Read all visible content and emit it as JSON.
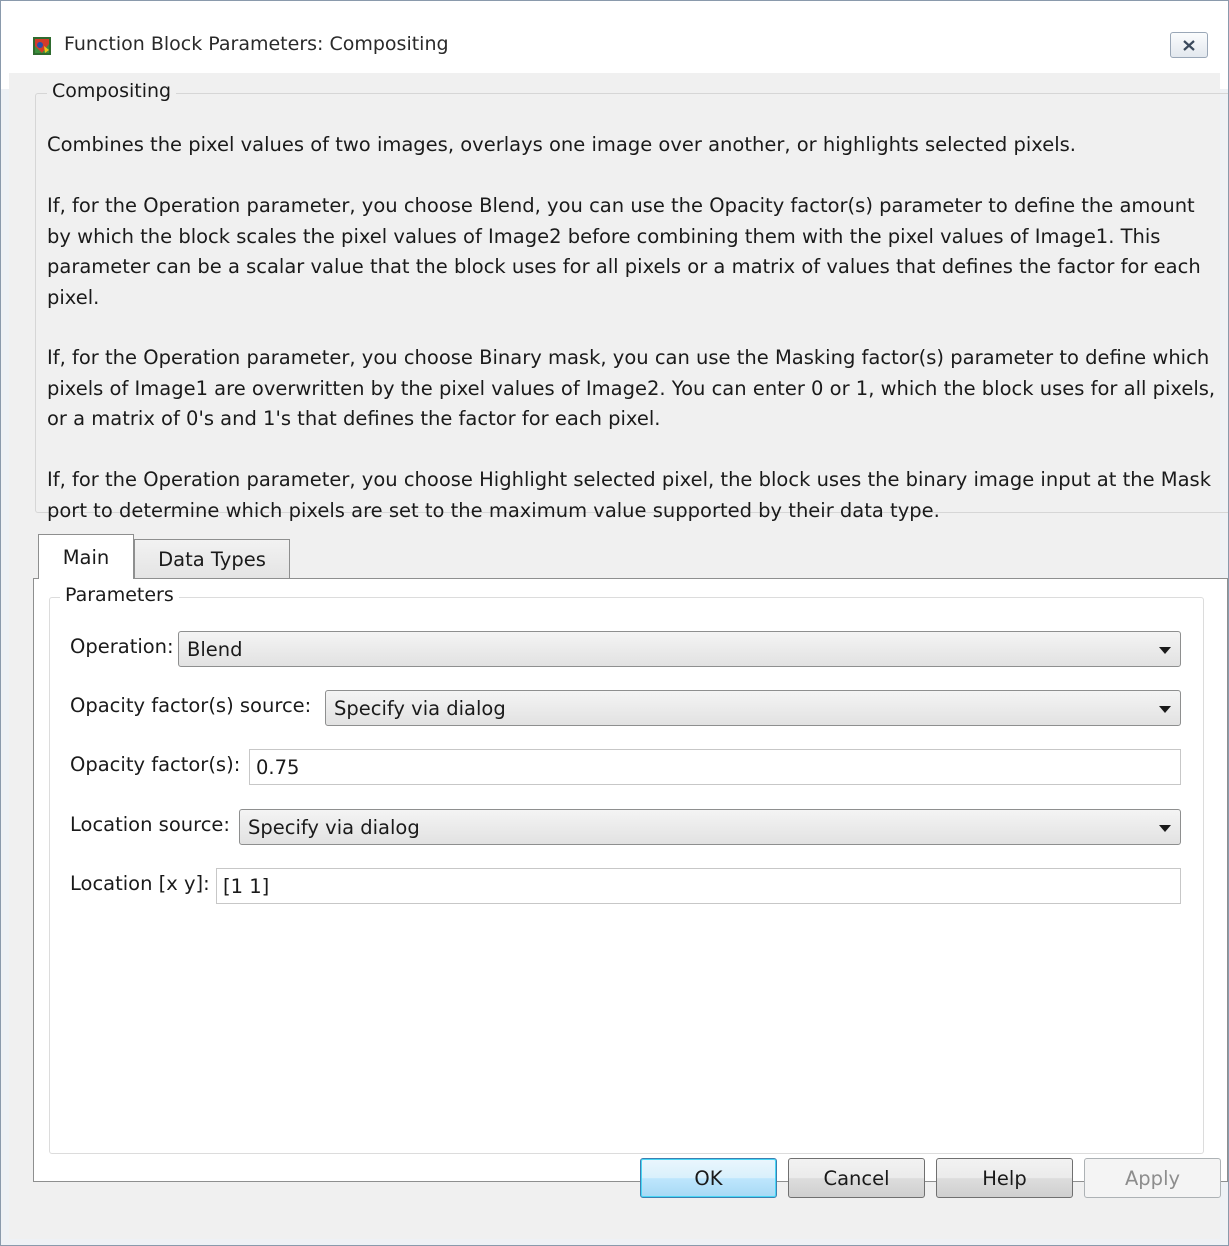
{
  "window": {
    "title": "Function Block Parameters: Compositing",
    "icon": "simulink-block-icon",
    "close_icon": "close-icon"
  },
  "description": {
    "group_label": "Compositing",
    "paragraphs": [
      "Combines the pixel values of two images, overlays one image over another, or highlights selected pixels.",
      "If, for the Operation parameter, you choose Blend, you can use the Opacity factor(s) parameter to define the amount by which the block scales the pixel values of Image2 before combining them with the pixel values of Image1. This parameter can be a scalar value that the block uses for all pixels or a matrix of values that defines the factor for each pixel.",
      "If, for the Operation parameter, you choose Binary mask, you can use the Masking factor(s) parameter to define which pixels of Image1 are overwritten by the pixel values of Image2. You can enter 0 or 1, which the block uses for all pixels, or a matrix of 0's and 1's that defines the factor for each pixel.",
      "If, for the Operation parameter, you choose Highlight selected pixel, the block uses the binary image input at the Mask port to determine which pixels are set to the maximum value supported by their data type."
    ]
  },
  "tabs": [
    {
      "label": "Main",
      "active": true
    },
    {
      "label": "Data Types",
      "active": false
    }
  ],
  "parameters": {
    "group_label": "Parameters",
    "operation": {
      "label": "Operation:",
      "value": "Blend"
    },
    "opacity_source": {
      "label": "Opacity factor(s) source:",
      "value": "Specify via dialog"
    },
    "opacity": {
      "label": "Opacity factor(s):",
      "value": "0.75"
    },
    "location_source": {
      "label": "Location source:",
      "value": "Specify via dialog"
    },
    "location": {
      "label": "Location [x y]:",
      "value": "[1 1]"
    }
  },
  "buttons": {
    "ok": "OK",
    "cancel": "Cancel",
    "help": "Help",
    "apply": "Apply"
  }
}
